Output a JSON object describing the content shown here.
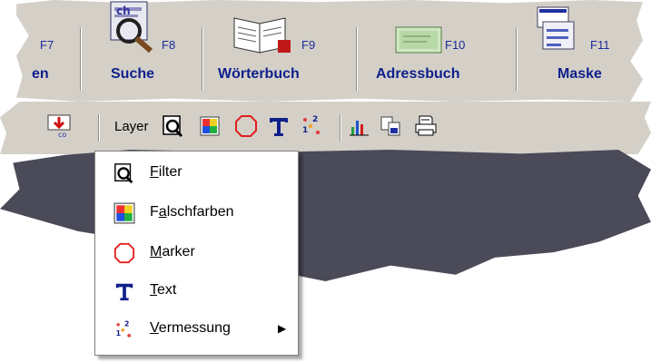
{
  "toolbar_top": {
    "keys": [
      {
        "key": "F7",
        "label": "en"
      },
      {
        "key": "F8",
        "label": "Suche"
      },
      {
        "key": "F9",
        "label": "Wörterbuch"
      },
      {
        "key": "F10",
        "label": "Adressbuch"
      },
      {
        "key": "F11",
        "label": "Maske"
      }
    ]
  },
  "toolbar": {
    "layer_label": "Layer",
    "icons": [
      "import-icon",
      "filter-icon",
      "falschfarben-icon",
      "marker-icon",
      "text-icon",
      "vermessung-icon",
      "chart-icon",
      "export-icon",
      "print-icon"
    ]
  },
  "menu": {
    "items": [
      {
        "icon": "filter-icon",
        "accel": "F",
        "rest": "ilter"
      },
      {
        "icon": "falschfarben-icon",
        "pre": "F",
        "accel": "a",
        "rest": "lschfarben"
      },
      {
        "icon": "marker-icon",
        "accel": "M",
        "rest": "arker"
      },
      {
        "icon": "text-icon",
        "accel": "T",
        "rest": "ext"
      },
      {
        "icon": "vermessung-icon",
        "accel": "V",
        "rest": "ermessung",
        "submenu": true
      }
    ],
    "colors": {
      "label": "#0f1f8c",
      "marker": "#e02020",
      "text_icon": "#10208a"
    }
  }
}
